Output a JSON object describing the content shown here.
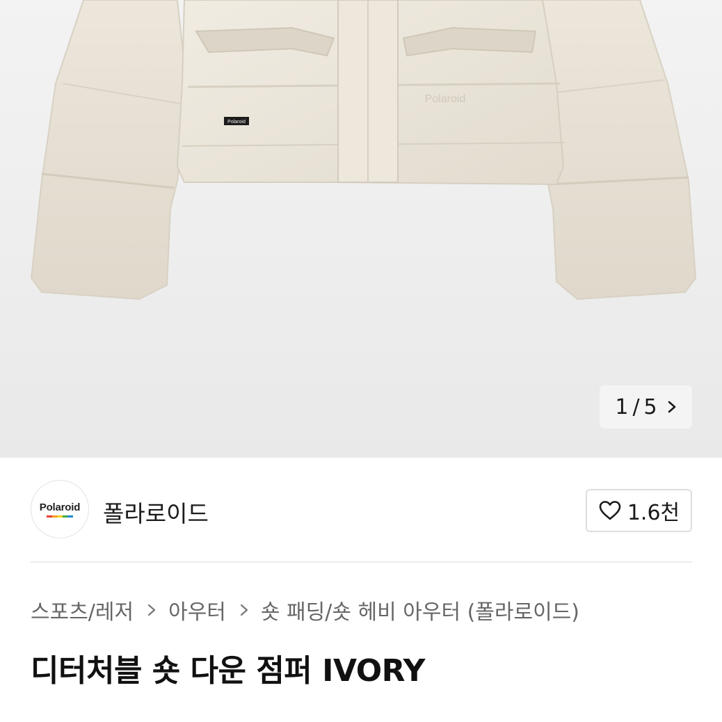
{
  "gallery": {
    "current": "1",
    "separator": "/",
    "total": "5",
    "image_text": "Polaroid",
    "label_text": "Polaroid",
    "next_icon": "chevron-right-icon"
  },
  "shop": {
    "logo_text": "Polaroid",
    "logo_colors": [
      "#e83e2f",
      "#f39a1e",
      "#f5d01d",
      "#41a74a",
      "#1e88d2"
    ],
    "name": "폴라로이드",
    "like_icon": "heart-outline-icon",
    "like_count": "1.6천"
  },
  "breadcrumb": {
    "items": [
      "스포츠/레저",
      "아우터",
      "숏 패딩/숏 헤비 아우터 (폴라로이드)"
    ],
    "separator_icon": "chevron-right-icon"
  },
  "product": {
    "title": "디터처블 숏 다운 점퍼 IVORY"
  }
}
